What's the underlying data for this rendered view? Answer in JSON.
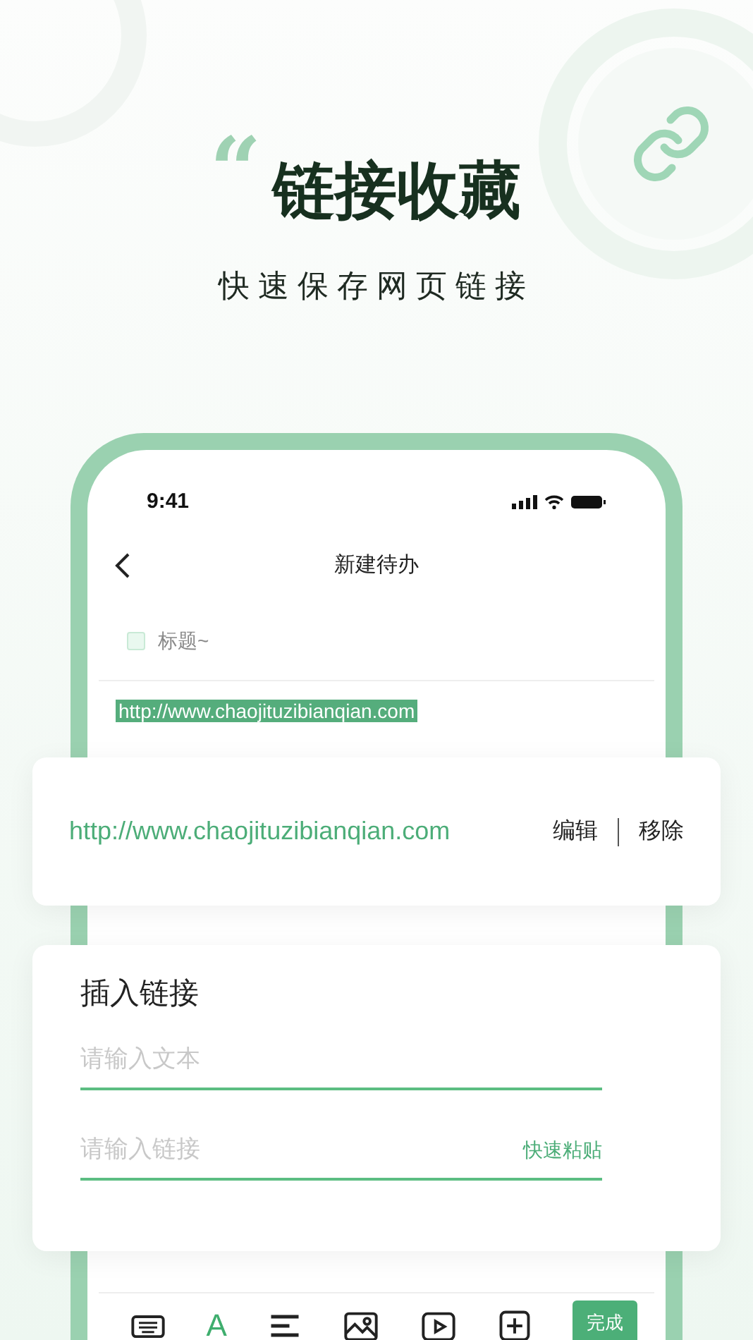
{
  "hero": {
    "quote_mark": "“",
    "title": "链接收藏",
    "subtitle": "快速保存网页链接"
  },
  "phone": {
    "status_bar": {
      "time": "9:41"
    },
    "header": {
      "title": "新建待办"
    },
    "title_field": {
      "placeholder": "标题~",
      "checked": false
    },
    "link_text": "http://www.chaojituzibianqian.com",
    "toolbar": {
      "items": [
        {
          "kind": "keyboard",
          "selected": false
        },
        {
          "kind": "text",
          "label": "A",
          "selected": true
        },
        {
          "kind": "align",
          "selected": false
        },
        {
          "kind": "image",
          "selected": false
        },
        {
          "kind": "video",
          "selected": false
        },
        {
          "kind": "add",
          "selected": false
        }
      ],
      "done_button": "完成"
    }
  },
  "link_popup": {
    "url": "http://www.chaojituzibianqian.com",
    "actions": [
      "编辑",
      "移除"
    ]
  },
  "insert_dialog": {
    "title": "插入链接",
    "fields": [
      {
        "placeholder": "请输入文本"
      },
      {
        "placeholder": "请输入链接",
        "action": "快速粘贴"
      }
    ]
  }
}
